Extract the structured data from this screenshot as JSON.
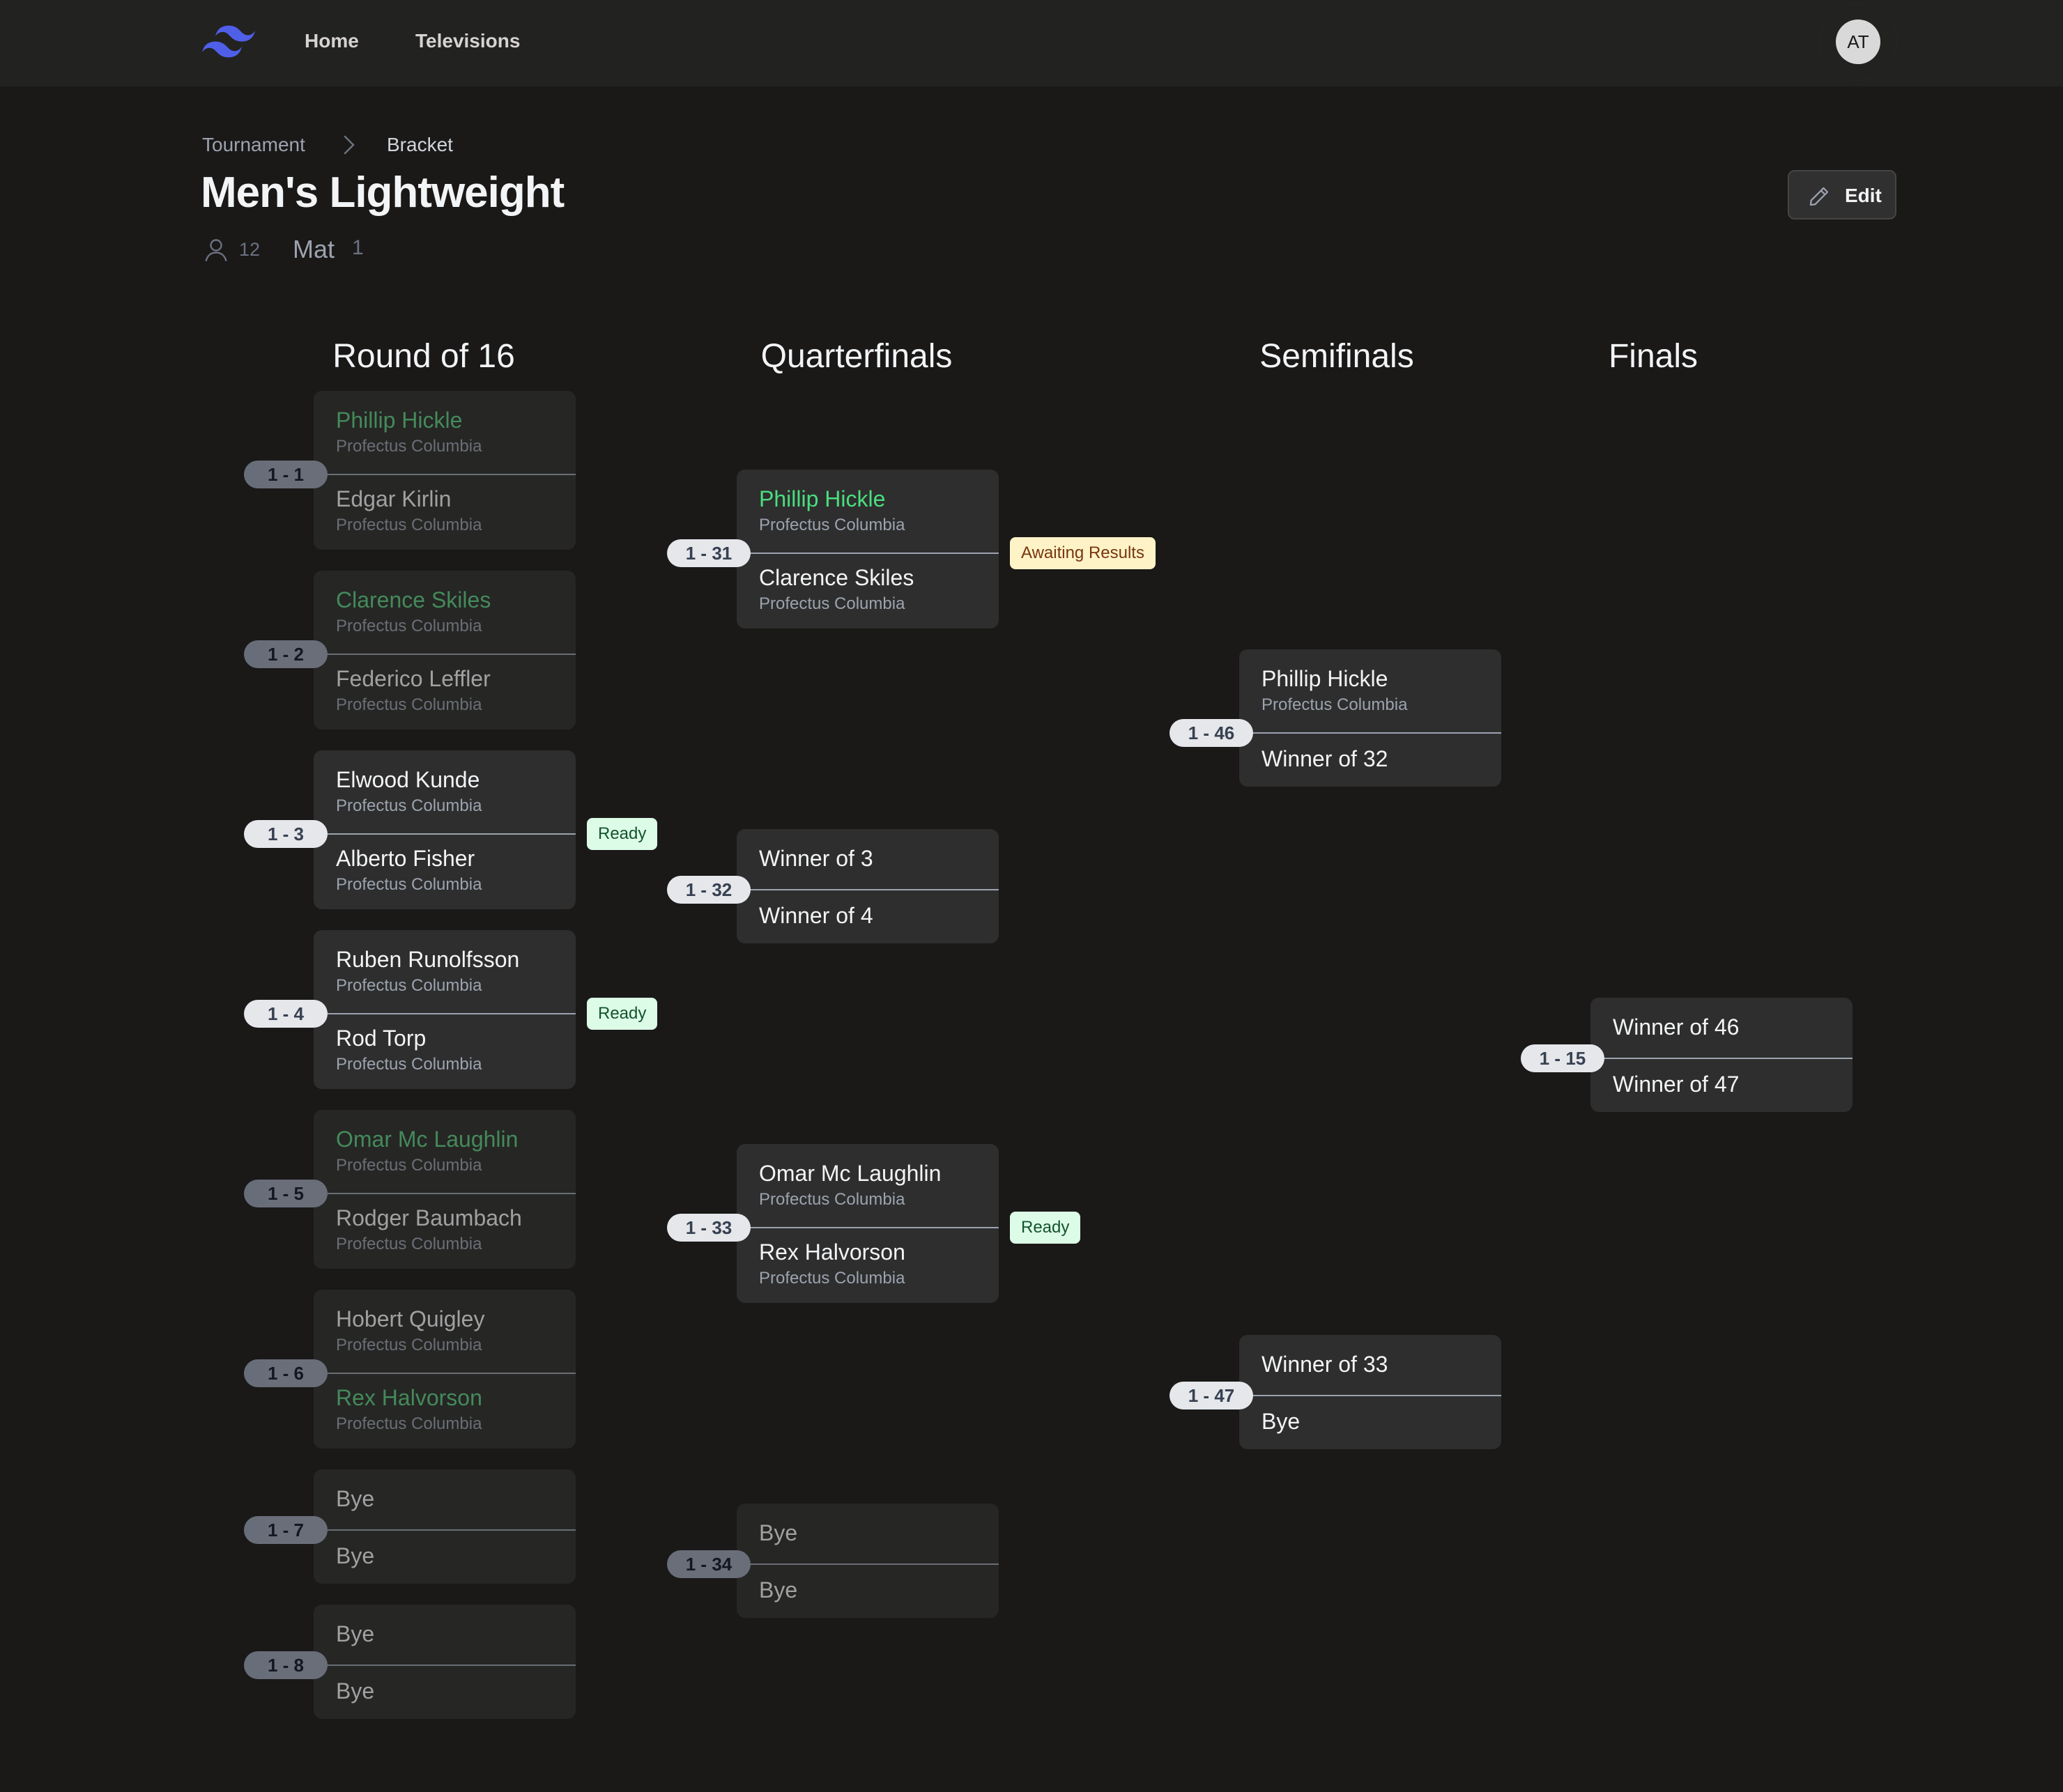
{
  "nav": {
    "logo": "tailwind-wave-logo",
    "links": [
      "Home",
      "Televisions"
    ],
    "avatar_initials": "AT"
  },
  "breadcrumb": [
    "Tournament",
    "Bracket"
  ],
  "page": {
    "title": "Men's Lightweight",
    "participants": "12",
    "mat_label": "Mat",
    "mat_value": "1",
    "edit_label": "Edit"
  },
  "colors": {
    "accent_logo": "#4f5fe8",
    "winner_green": "#4ade80",
    "ready_bg": "#dcfce7",
    "ready_text": "#14532d",
    "awaiting_bg": "#fef3c7",
    "awaiting_text": "#78350f",
    "card_bg": "#2e2e2e",
    "page_bg": "#1a1918"
  },
  "rounds": [
    {
      "title": "Round of 16",
      "matches": [
        {
          "id": "1 - 1",
          "dim": true,
          "status": null,
          "top": {
            "name": "Phillip Hickle",
            "team": "Profectus Columbia",
            "winner": true
          },
          "bottom": {
            "name": "Edgar Kirlin",
            "team": "Profectus Columbia",
            "winner": false
          }
        },
        {
          "id": "1 - 2",
          "dim": true,
          "status": null,
          "top": {
            "name": "Clarence Skiles",
            "team": "Profectus Columbia",
            "winner": true
          },
          "bottom": {
            "name": "Federico Leffler",
            "team": "Profectus Columbia",
            "winner": false
          }
        },
        {
          "id": "1 - 3",
          "dim": false,
          "status": "Ready",
          "top": {
            "name": "Elwood Kunde",
            "team": "Profectus Columbia",
            "winner": false
          },
          "bottom": {
            "name": "Alberto Fisher",
            "team": "Profectus Columbia",
            "winner": false
          }
        },
        {
          "id": "1 - 4",
          "dim": false,
          "status": "Ready",
          "top": {
            "name": "Ruben Runolfsson",
            "team": "Profectus Columbia",
            "winner": false
          },
          "bottom": {
            "name": "Rod Torp",
            "team": "Profectus Columbia",
            "winner": false
          }
        },
        {
          "id": "1 - 5",
          "dim": true,
          "status": null,
          "top": {
            "name": "Omar Mc Laughlin",
            "team": "Profectus Columbia",
            "winner": true
          },
          "bottom": {
            "name": "Rodger Baumbach",
            "team": "Profectus Columbia",
            "winner": false
          }
        },
        {
          "id": "1 - 6",
          "dim": true,
          "status": null,
          "top": {
            "name": "Hobert Quigley",
            "team": "Profectus Columbia",
            "winner": false
          },
          "bottom": {
            "name": "Rex Halvorson",
            "team": "Profectus Columbia",
            "winner": true
          }
        },
        {
          "id": "1 - 7",
          "dim": true,
          "status": null,
          "top": {
            "name": "Bye",
            "team": null,
            "winner": false
          },
          "bottom": {
            "name": "Bye",
            "team": null,
            "winner": false
          }
        },
        {
          "id": "1 - 8",
          "dim": true,
          "status": null,
          "top": {
            "name": "Bye",
            "team": null,
            "winner": false
          },
          "bottom": {
            "name": "Bye",
            "team": null,
            "winner": false
          }
        }
      ]
    },
    {
      "title": "Quarterfinals",
      "matches": [
        {
          "id": "1 - 31",
          "dim": false,
          "status": "Awaiting Results",
          "top": {
            "name": "Phillip Hickle",
            "team": "Profectus Columbia",
            "winner": true
          },
          "bottom": {
            "name": "Clarence Skiles",
            "team": "Profectus Columbia",
            "winner": false
          }
        },
        {
          "id": "1 - 32",
          "dim": false,
          "status": null,
          "top": {
            "name": "Winner of 3",
            "team": null,
            "winner": false
          },
          "bottom": {
            "name": "Winner of 4",
            "team": null,
            "winner": false
          }
        },
        {
          "id": "1 - 33",
          "dim": false,
          "status": "Ready",
          "top": {
            "name": "Omar Mc Laughlin",
            "team": "Profectus Columbia",
            "winner": false
          },
          "bottom": {
            "name": "Rex Halvorson",
            "team": "Profectus Columbia",
            "winner": false
          }
        },
        {
          "id": "1 - 34",
          "dim": true,
          "status": null,
          "top": {
            "name": "Bye",
            "team": null,
            "winner": false
          },
          "bottom": {
            "name": "Bye",
            "team": null,
            "winner": false
          }
        }
      ]
    },
    {
      "title": "Semifinals",
      "matches": [
        {
          "id": "1 - 46",
          "dim": false,
          "status": null,
          "top": {
            "name": "Phillip Hickle",
            "team": "Profectus Columbia",
            "winner": false
          },
          "bottom": {
            "name": "Winner of 32",
            "team": null,
            "winner": false
          }
        },
        {
          "id": "1 - 47",
          "dim": false,
          "status": null,
          "top": {
            "name": "Winner of 33",
            "team": null,
            "winner": false
          },
          "bottom": {
            "name": "Bye",
            "team": null,
            "winner": false
          }
        }
      ]
    },
    {
      "title": "Finals",
      "matches": [
        {
          "id": "1 - 15",
          "dim": false,
          "status": null,
          "top": {
            "name": "Winner of 46",
            "team": null,
            "winner": false
          },
          "bottom": {
            "name": "Winner of 47",
            "team": null,
            "winner": false
          }
        }
      ]
    }
  ]
}
